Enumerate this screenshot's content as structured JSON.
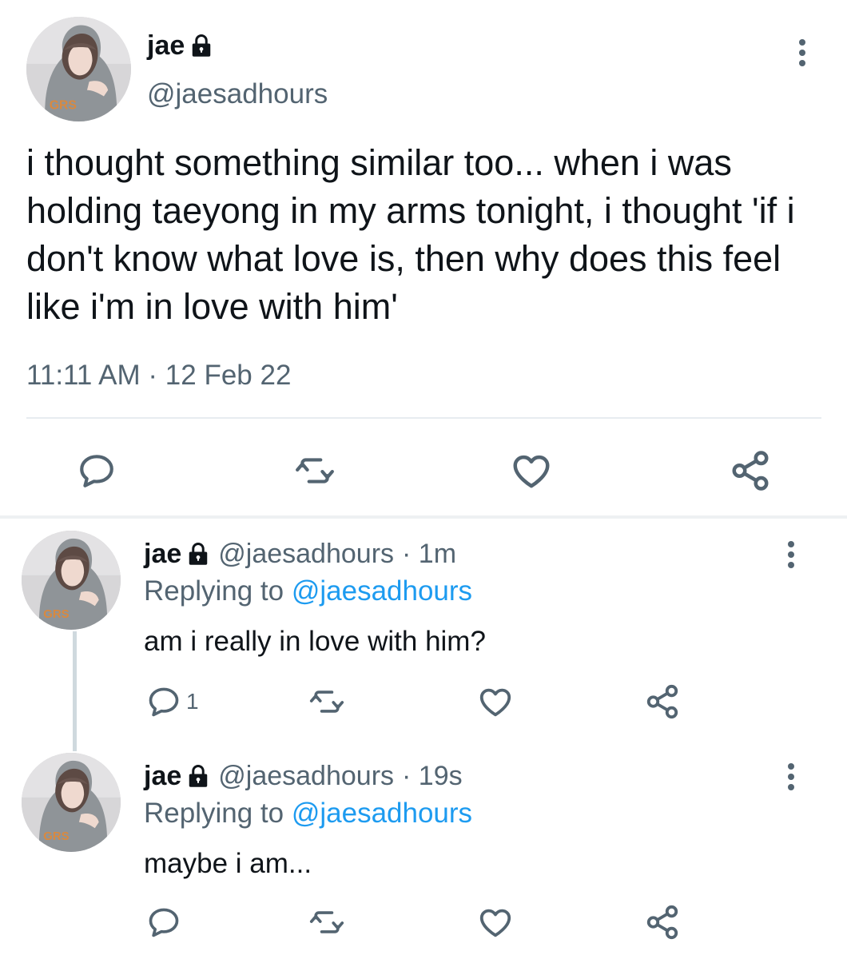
{
  "main_tweet": {
    "name": "jae",
    "handle": "@jaesadhours",
    "text": "i thought something similar too... when i was holding taeyong in my arms tonight, i thought 'if i don't know what love is, then why does this feel like i'm in love with him'",
    "time": "11:11 AM · 12 Feb 22"
  },
  "replies": [
    {
      "name": "jae",
      "handle": "@jaesadhours",
      "age": "· 1m",
      "replying_prefix": "Replying to ",
      "replying_to": "@jaesadhours",
      "text": "am i really in love with him?",
      "reply_count": "1"
    },
    {
      "name": "jae",
      "handle": "@jaesadhours",
      "age": "· 19s",
      "replying_prefix": "Replying to ",
      "replying_to": "@jaesadhours",
      "text": "maybe i am...",
      "reply_count": ""
    }
  ],
  "icons": {
    "lock": "lock-icon",
    "reply": "reply-icon",
    "retweet": "retweet-icon",
    "like": "heart-icon",
    "share": "share-icon",
    "more": "more-vertical-icon"
  },
  "colors": {
    "text": "#0f1419",
    "secondary": "#536471",
    "link": "#1d9bf0",
    "divider": "#e7ecf0"
  }
}
